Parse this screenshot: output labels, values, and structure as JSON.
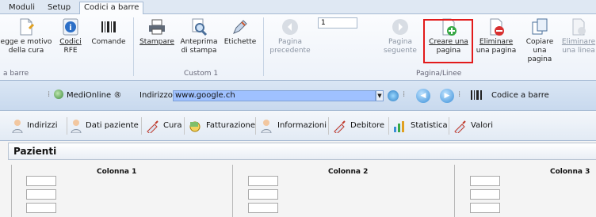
{
  "ribbon_tabs": [
    "Moduli",
    "Setup",
    "Codici a barre"
  ],
  "ribbon": {
    "btn_legge": [
      "egge e motivo",
      "della cura"
    ],
    "btn_codici": [
      "Codici",
      "RFE"
    ],
    "btn_comande": "Comande",
    "group_left": "a barre",
    "btn_stampare": "Stampare",
    "btn_anteprima": [
      "Anteprima",
      "di stampa"
    ],
    "btn_etichette": "Etichette",
    "group_custom": "Custom 1",
    "btn_pagina_prec": [
      "Pagina",
      "precedente"
    ],
    "page_number": "1",
    "btn_pagina_seg": [
      "Pagina",
      "seguente"
    ],
    "btn_creare": [
      "Creare una",
      "pagina"
    ],
    "btn_eliminare": [
      "Eliminare",
      "una pagina"
    ],
    "btn_copiare": [
      "Copiare",
      "una pagina"
    ],
    "btn_eliminare_linea": [
      "Eliminare",
      "una linea"
    ],
    "group_pagina": "Pagina/Linee"
  },
  "address_bar": {
    "medionline": "MediOnline ®",
    "indirizzo_label": "Indirizzo",
    "url": "www.google.ch",
    "codice": "Codice a barre"
  },
  "nav": [
    "Indirizzi",
    "Dati paziente",
    "Cura",
    "Fatturazione",
    "Informazioni",
    "Debitore",
    "Statistica",
    "Valori"
  ],
  "content": {
    "title": "Pazienti",
    "columns": [
      "Colonna 1",
      "Colonna 2",
      "Colonna 3"
    ]
  },
  "colors": {
    "highlight": "#e21b1b",
    "url_bg": "#9fc1ff"
  }
}
